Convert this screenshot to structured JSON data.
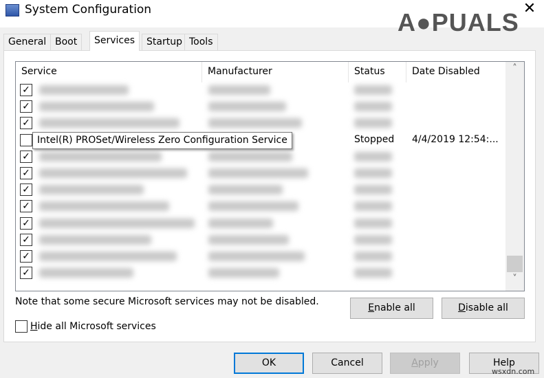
{
  "window": {
    "title": "System Configuration",
    "close": "✕",
    "logo": "APPUALS",
    "watermark": "wsxdn.com"
  },
  "tabs": [
    {
      "label": "General"
    },
    {
      "label": "Boot"
    },
    {
      "label": "Services",
      "active": true
    },
    {
      "label": "Startup"
    },
    {
      "label": "Tools"
    }
  ],
  "columns": {
    "service": "Service",
    "manufacturer": "Manufacturer",
    "status": "Status",
    "date_disabled": "Date Disabled"
  },
  "rows": [
    {
      "checked": true
    },
    {
      "checked": true
    },
    {
      "checked": true
    },
    {
      "checked": false,
      "status": "Stopped",
      "date_disabled": "4/4/2019 12:54:..."
    },
    {
      "checked": true
    },
    {
      "checked": true
    },
    {
      "checked": true
    },
    {
      "checked": true
    },
    {
      "checked": true
    },
    {
      "checked": true
    },
    {
      "checked": true
    },
    {
      "checked": true
    }
  ],
  "tooltip": "Intel(R) PROSet/Wireless Zero Configuration Service",
  "note": "Note that some secure Microsoft services may not be disabled.",
  "buttons": {
    "enable_all_u": "E",
    "enable_all": "nable all",
    "disable_all_u": "D",
    "disable_all": "isable all",
    "ok": "OK",
    "cancel": "Cancel",
    "apply_u": "A",
    "apply": "pply",
    "help": "Help"
  },
  "hide_ms": {
    "label_u": "H",
    "label": "ide all Microsoft services",
    "checked": false
  }
}
